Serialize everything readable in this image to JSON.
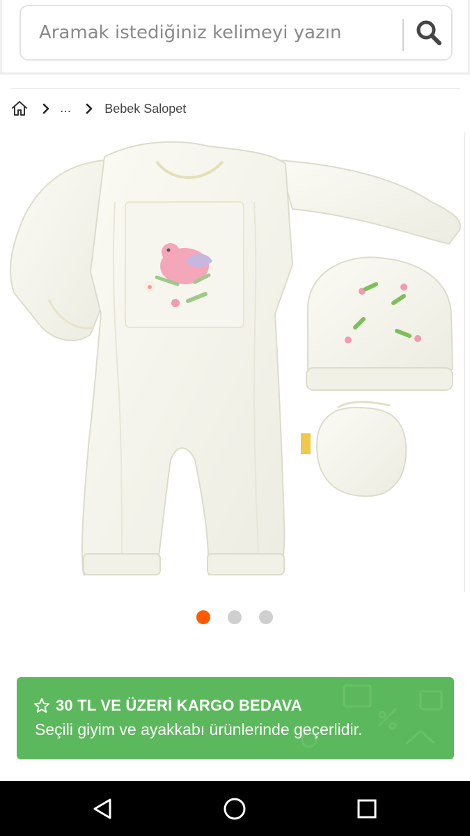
{
  "search": {
    "placeholder": "Aramak istediğiniz kelimeyi yazın",
    "button_icon": "search-icon"
  },
  "breadcrumb": {
    "home_icon": "home-icon",
    "ellipsis": "...",
    "current": "Bebek Salopet"
  },
  "carousel": {
    "image_alt": "Bebek salopet, bere ve eldiven seti",
    "slide_count": 3,
    "active_index": 0,
    "active_color": "#ff5a00",
    "inactive_color": "#cfcfcf"
  },
  "promo": {
    "icon": "star-outline-icon",
    "title": "30 TL VE ÜZERİ KARGO BEDAVA",
    "subtitle": "Seçili giyim ve ayakkabı ürünlerinde geçerlidir.",
    "background": "#5cb85c"
  },
  "system_nav": {
    "back_icon": "back-triangle-icon",
    "home_icon": "home-circle-icon",
    "recents_icon": "recents-square-icon"
  }
}
